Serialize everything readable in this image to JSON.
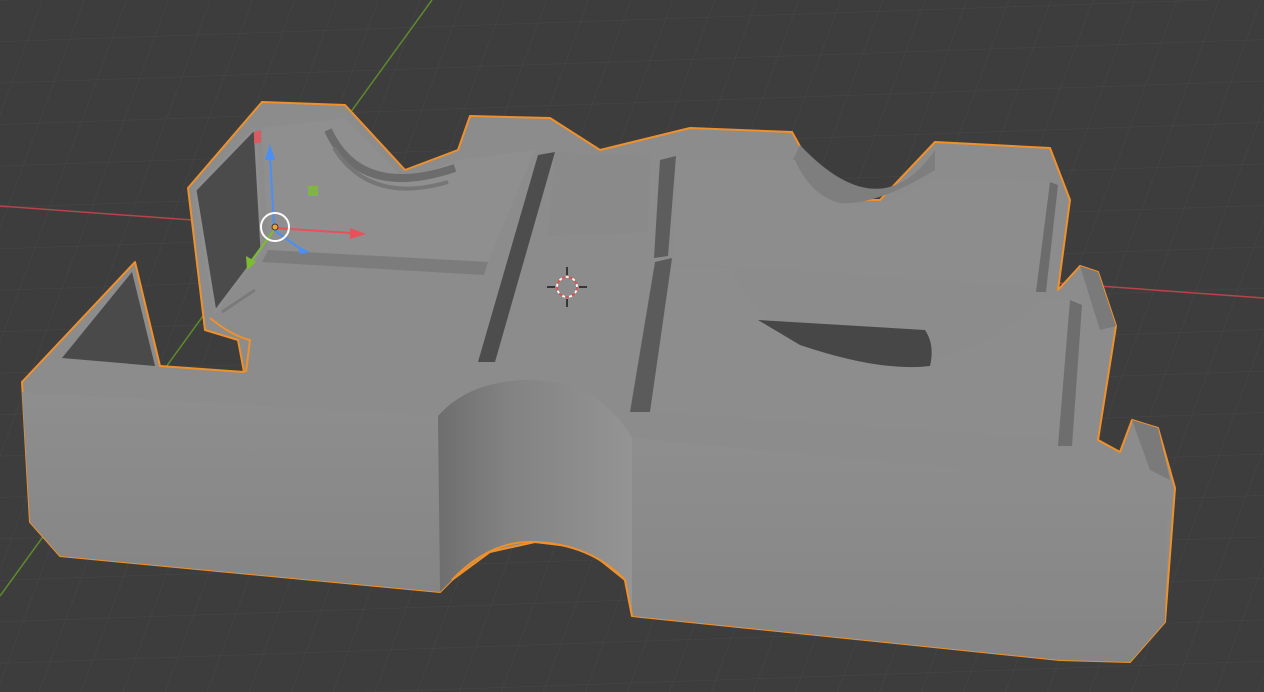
{
  "viewport": {
    "mode": "3d-viewport-solid-shading",
    "background_color": "#3d3d3d",
    "grid_color": "#4a4a4a",
    "x_axis_color": "#c0444f",
    "y_axis_color": "#6e9a30",
    "selection_outline_color": "#f0902a",
    "object_color": "#8a8a8a"
  },
  "selected_object": {
    "type": "mesh",
    "selected": true
  },
  "gizmo": {
    "type": "move-rotate-scale-transform",
    "x_axis_color": "#e8515a",
    "y_axis_color": "#7cbd2f",
    "z_axis_color": "#4a8ff5",
    "plane_handle_color": "#7cbd2f"
  },
  "cursor_3d": {
    "icon": "3d-cursor-icon"
  }
}
